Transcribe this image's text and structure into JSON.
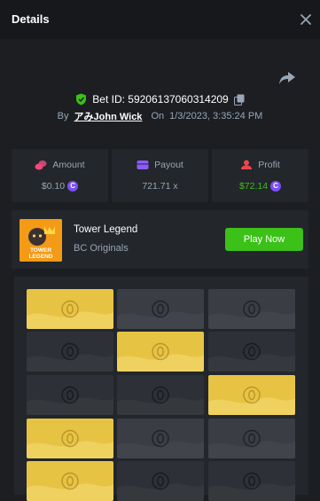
{
  "header": {
    "title": "Details"
  },
  "bet": {
    "id_label": "Bet ID: 59206137060314209"
  },
  "byline": {
    "by": "By",
    "user": "アみJohn Wick",
    "on": "On",
    "datetime": "1/3/2023, 3:35:24 PM"
  },
  "stats": {
    "amount_label": "Amount",
    "amount_value": "$0.10",
    "payout_label": "Payout",
    "payout_value": "721.71 x",
    "profit_label": "Profit",
    "profit_value": "$72.14"
  },
  "coin_symbol": "C",
  "game": {
    "name": "Tower Legend",
    "provider": "BC Originals",
    "play_label": "Play Now",
    "thumb_text_1": "TOWER",
    "thumb_text_2": "LEGEND"
  },
  "board": {
    "rows": [
      [
        "gold",
        "grey",
        "grey"
      ],
      [
        "dark",
        "gold",
        "dark"
      ],
      [
        "dark",
        "dark",
        "gold"
      ],
      [
        "gold",
        "grey",
        "grey"
      ],
      [
        "gold",
        "dark",
        "dark"
      ]
    ]
  },
  "colors": {
    "accent_green": "#3bc117",
    "tile_gold": "#e7c344",
    "coin_purple": "#7b4ff7",
    "background": "#1c1e22"
  },
  "icons": {
    "close": "close-icon",
    "share": "share-icon",
    "shield": "shield-check-icon",
    "copy": "copy-icon",
    "amount": "coins-icon",
    "payout": "wallet-icon",
    "profit": "profit-icon",
    "tile": "egg-icon"
  }
}
